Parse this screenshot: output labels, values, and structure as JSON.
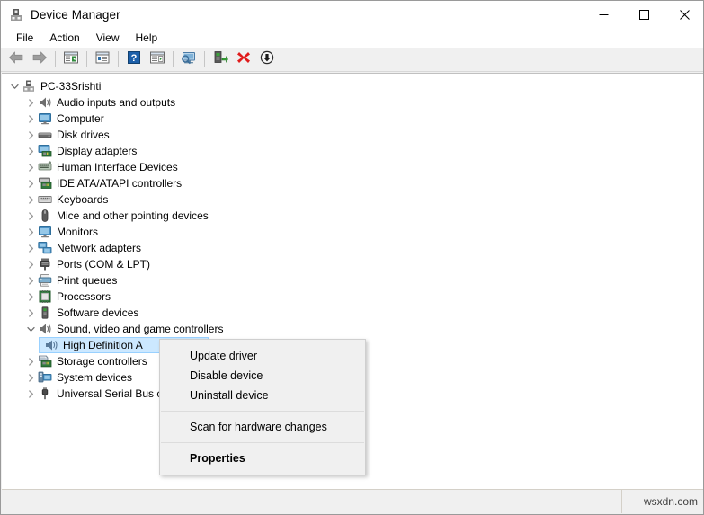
{
  "window": {
    "title": "Device Manager",
    "icon": "device-manager-icon",
    "controls": {
      "minimize": "–",
      "maximize": "☐",
      "close": "✕"
    }
  },
  "menubar": {
    "items": [
      {
        "label": "File"
      },
      {
        "label": "Action"
      },
      {
        "label": "View"
      },
      {
        "label": "Help"
      }
    ]
  },
  "toolbar": {
    "buttons": [
      {
        "name": "back-button",
        "icon": "left-arrow-icon"
      },
      {
        "name": "forward-button",
        "icon": "right-arrow-icon"
      },
      {
        "name": "separator-1",
        "icon": "separator"
      },
      {
        "name": "show-hide-console-tree-button",
        "icon": "console-tree-icon"
      },
      {
        "name": "separator-2",
        "icon": "separator"
      },
      {
        "name": "properties-button",
        "icon": "properties-icon"
      },
      {
        "name": "separator-3",
        "icon": "separator"
      },
      {
        "name": "help-button",
        "icon": "question-mark-icon"
      },
      {
        "name": "show-hide-action-pane-button",
        "icon": "action-pane-icon"
      },
      {
        "name": "separator-4",
        "icon": "separator"
      },
      {
        "name": "scan-for-hardware-changes-button",
        "icon": "scan-hardware-icon"
      },
      {
        "name": "separator-5",
        "icon": "separator"
      },
      {
        "name": "update-driver-button",
        "icon": "update-driver-icon"
      },
      {
        "name": "uninstall-device-button",
        "icon": "red-x-icon"
      },
      {
        "name": "disable-device-button",
        "icon": "down-arrow-circle-icon"
      }
    ]
  },
  "tree": {
    "root": {
      "label": "PC-33Srishti",
      "icon": "computer-root-icon",
      "expanded": true
    },
    "nodes": [
      {
        "label": "Audio inputs and outputs",
        "icon": "speaker-icon",
        "expanded": false
      },
      {
        "label": "Computer",
        "icon": "monitor-icon",
        "expanded": false
      },
      {
        "label": "Disk drives",
        "icon": "disk-drive-icon",
        "expanded": false
      },
      {
        "label": "Display adapters",
        "icon": "display-adapter-icon",
        "expanded": false
      },
      {
        "label": "Human Interface Devices",
        "icon": "hid-icon",
        "expanded": false
      },
      {
        "label": "IDE ATA/ATAPI controllers",
        "icon": "ide-controller-icon",
        "expanded": false
      },
      {
        "label": "Keyboards",
        "icon": "keyboard-icon",
        "expanded": false
      },
      {
        "label": "Mice and other pointing devices",
        "icon": "mouse-icon",
        "expanded": false
      },
      {
        "label": "Monitors",
        "icon": "monitor-icon",
        "expanded": false
      },
      {
        "label": "Network adapters",
        "icon": "network-adapter-icon",
        "expanded": false
      },
      {
        "label": "Ports (COM & LPT)",
        "icon": "port-icon",
        "expanded": false
      },
      {
        "label": "Print queues",
        "icon": "printer-icon",
        "expanded": false
      },
      {
        "label": "Processors",
        "icon": "processor-icon",
        "expanded": false
      },
      {
        "label": "Software devices",
        "icon": "software-device-icon",
        "expanded": false
      },
      {
        "label": "Sound, video and game controllers",
        "icon": "speaker-icon",
        "expanded": true
      },
      {
        "label": "Storage controllers",
        "icon": "storage-controller-icon",
        "expanded": false
      },
      {
        "label": "System devices",
        "icon": "system-device-icon",
        "expanded": false
      },
      {
        "label": "Universal Serial Bus c",
        "icon": "usb-icon",
        "expanded": false
      }
    ],
    "selected_child": {
      "label": "High Definition A",
      "icon": "speaker-icon",
      "parent": "Sound, video and game controllers",
      "selected": true
    }
  },
  "context_menu": {
    "groups": [
      {
        "items": [
          {
            "label": "Update driver",
            "bold": false
          },
          {
            "label": "Disable device",
            "bold": false
          },
          {
            "label": "Uninstall device",
            "bold": false
          }
        ]
      },
      {
        "items": [
          {
            "label": "Scan for hardware changes",
            "bold": false
          }
        ]
      },
      {
        "items": [
          {
            "label": "Properties",
            "bold": true
          }
        ]
      }
    ]
  },
  "statusbar": {
    "left": "",
    "middle": "",
    "right": "wsxdn.com"
  },
  "colors": {
    "selection_fill": "#cce8ff",
    "selection_border": "#99d1ff",
    "toolbar_bg": "#f0f0f0",
    "tree_bg": "#ffffff",
    "accent_red": "#e00000",
    "accent_blue": "#1b5faa",
    "accent_green": "#3a9a3a"
  }
}
